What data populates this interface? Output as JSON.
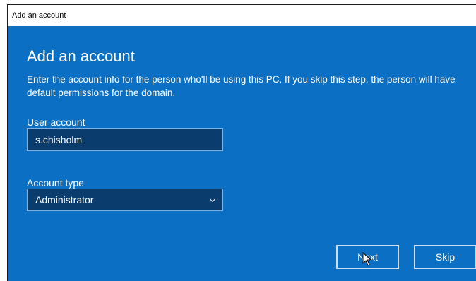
{
  "window": {
    "title": "Add an account"
  },
  "main": {
    "heading": "Add an account",
    "description": "Enter the account info for the person who'll be using this PC. If you skip this step, the person will have default permissions for the domain.",
    "user_account": {
      "label": "User account",
      "value": "s.chisholm"
    },
    "account_type": {
      "label": "Account type",
      "selected": "Administrator"
    }
  },
  "buttons": {
    "next_label": "Next",
    "skip_label": "Skip"
  },
  "colors": {
    "accent": "#0b6fc3",
    "field_bg": "#0a3d6e"
  }
}
